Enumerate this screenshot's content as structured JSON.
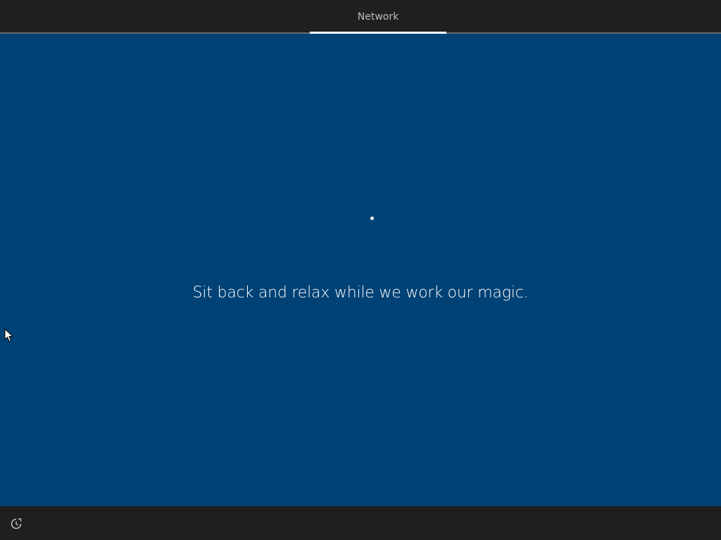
{
  "header": {
    "tabs": [
      {
        "label": "Network",
        "active": true
      }
    ]
  },
  "main": {
    "message": "Sit back and relax while we work our magic."
  },
  "footer": {
    "accessibility_icon": "ease-of-access-icon"
  },
  "colors": {
    "background": "#004275",
    "bar": "#1f1f1f",
    "text": "#ffffff",
    "tab_text": "#bcbcbc"
  }
}
